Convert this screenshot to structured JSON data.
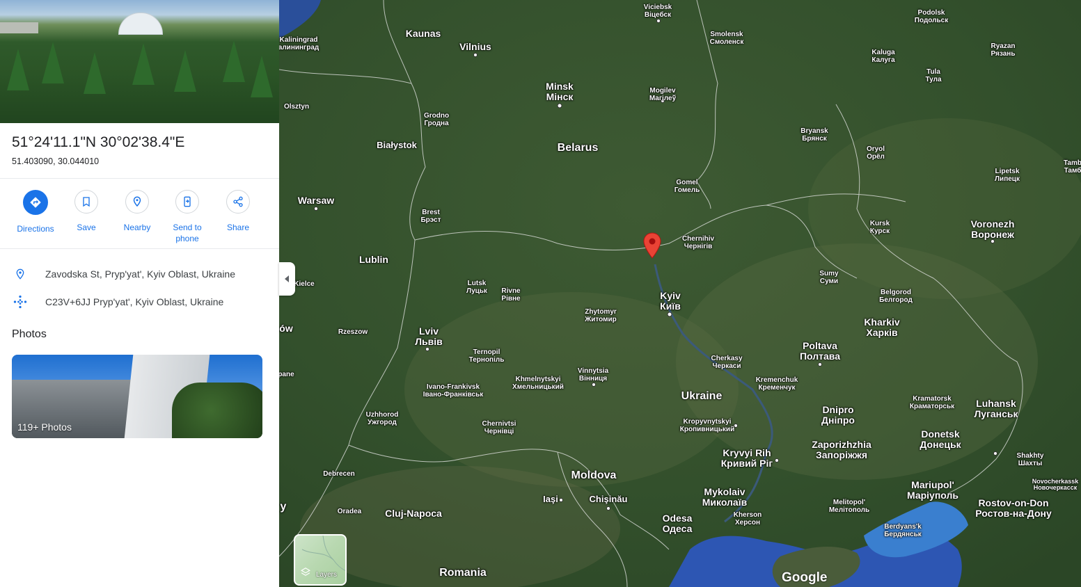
{
  "place": {
    "title": "51°24'11.1\"N 30°02'38.4\"E",
    "decimal": "51.403090, 30.044010"
  },
  "actions": [
    {
      "label": "Directions",
      "icon": "directions-icon"
    },
    {
      "label": "Save",
      "icon": "bookmark-icon"
    },
    {
      "label": "Nearby",
      "icon": "nearby-icon"
    },
    {
      "label": "Send to",
      "label2": "phone",
      "icon": "send-to-phone-icon"
    },
    {
      "label": "Share",
      "icon": "share-icon"
    }
  ],
  "info": {
    "address": "Zavodska St, Pryp'yat', Kyiv Oblast, Ukraine",
    "plus_code": "C23V+6JJ Pryp'yat', Kyiv Oblast, Ukraine"
  },
  "photos": {
    "heading": "Photos",
    "count": "119+ Photos"
  },
  "map": {
    "layers_label": "Layers",
    "logo": "Google",
    "labels": {
      "viciebsk": [
        "Viciebsk",
        "Віцебск"
      ],
      "podolsk": [
        "Podolsk",
        "Подольск"
      ],
      "kaliningrad": [
        "Kaliningrad",
        "алининград"
      ],
      "kaunas": [
        "Kaunas"
      ],
      "vilnius": [
        "Vilnius"
      ],
      "smolensk": [
        "Smolensk",
        "Смоленск"
      ],
      "kaluga": [
        "Kaluga",
        "Калуга"
      ],
      "ryazan": [
        "Ryazan",
        "Рязань"
      ],
      "tula": [
        "Tula",
        "Тула"
      ],
      "minsk": [
        "Minsk",
        "Мінск"
      ],
      "mogilev": [
        "Mogilev",
        "Магілеў"
      ],
      "olsztyn": [
        "Olsztyn"
      ],
      "grodno": [
        "Grodno",
        "Гродна"
      ],
      "bryansk": [
        "Bryansk",
        "Брянск"
      ],
      "bialystok": [
        "Białystok"
      ],
      "belarus": [
        "Belarus"
      ],
      "oryol": [
        "Oryol",
        "Орёл"
      ],
      "lipetsk": [
        "Lipetsk",
        "Липецк"
      ],
      "tamb": [
        "Tamb",
        "Тамб"
      ],
      "gomel": [
        "Gomel",
        "Гомель"
      ],
      "warsaw": [
        "Warsaw"
      ],
      "brest": [
        "Brest",
        "Брэст"
      ],
      "kursk": [
        "Kursk",
        "Курск"
      ],
      "voronezh": [
        "Voronezh",
        "Воронеж"
      ],
      "chernihiv": [
        "Chernihiv",
        "Чернігів"
      ],
      "lublin": [
        "Lublin"
      ],
      "sumy": [
        "Sumy",
        "Суми"
      ],
      "kielce": [
        "Kielce"
      ],
      "lutsk": [
        "Lutsk",
        "Луцьк"
      ],
      "rivne": [
        "Rivne",
        "Рівне"
      ],
      "kyiv": [
        "Kyiv",
        "Київ"
      ],
      "belgorod": [
        "Belgorod",
        "Белгород"
      ],
      "zhytomyr": [
        "Zhytomyr",
        "Житомир"
      ],
      "kharkiv": [
        "Kharkiv",
        "Харків"
      ],
      "krakow": [
        "ów"
      ],
      "rzeszow": [
        "Rzeszow"
      ],
      "lviv": [
        "Lviv",
        "Львів"
      ],
      "poltava": [
        "Poltava",
        "Полтава"
      ],
      "ternopil": [
        "Ternopil",
        "Тернопіль"
      ],
      "cherkasy": [
        "Cherkasy",
        "Черкаси"
      ],
      "vinnytsia": [
        "Vinnytsia",
        "Вінниця"
      ],
      "khmelnytskyi": [
        "Khmelnytskyi",
        "Хмельницький"
      ],
      "kremenchuk": [
        "Kremenchuk",
        "Кременчук"
      ],
      "ivano": [
        "Ivano-Frankivsk",
        "Івано-Франківськ"
      ],
      "ukraine": [
        "Ukraine"
      ],
      "kramatorsk": [
        "Kramatorsk",
        "Краматорськ"
      ],
      "luhansk": [
        "Luhansk",
        "Луганськ"
      ],
      "dnipro": [
        "Dnipro",
        "Дніпро"
      ],
      "uzhhorod": [
        "Uzhhorod",
        "Ужгород"
      ],
      "chernivtsi": [
        "Chernivtsi",
        "Чернівці"
      ],
      "kropyvnytskyi": [
        "Kropyvnytskyi",
        "Кропивницький"
      ],
      "zaporizhzhia": [
        "Zaporizhzhia",
        "Запоріжжя"
      ],
      "donetsk": [
        "Donetsk",
        "Донецьк"
      ],
      "kryvyi": [
        "Kryvyi Rih",
        "Кривий Ріг"
      ],
      "shakhty": [
        "Shakhty",
        "Шахты"
      ],
      "debrecen": [
        "Debrecen"
      ],
      "moldova": [
        "Moldova"
      ],
      "novocherkassk": [
        "Novocherkassk",
        "Новочеркасск"
      ],
      "mariupol": [
        "Mariupol'",
        "Маріуполь"
      ],
      "iasi": [
        "Iaşi"
      ],
      "chisinau": [
        "Chişinău"
      ],
      "mykolaiv": [
        "Mykolaiv",
        "Миколаїв"
      ],
      "melitopol": [
        "Melitopol'",
        "Мелітополь"
      ],
      "rostov": [
        "Rostov-on-Don",
        "Ростов-на-Дону"
      ],
      "oradea": [
        "Oradea"
      ],
      "cluj": [
        "Cluj-Napoca"
      ],
      "kherson": [
        "Kherson",
        "Херсон"
      ],
      "odesa": [
        "Odesa",
        "Одеса"
      ],
      "berdyansk": [
        "Berdyans'k",
        "Бердянськ"
      ],
      "romania": [
        "Romania"
      ],
      "pane": [
        "pane"
      ],
      "edge_y": [
        "y"
      ]
    }
  }
}
